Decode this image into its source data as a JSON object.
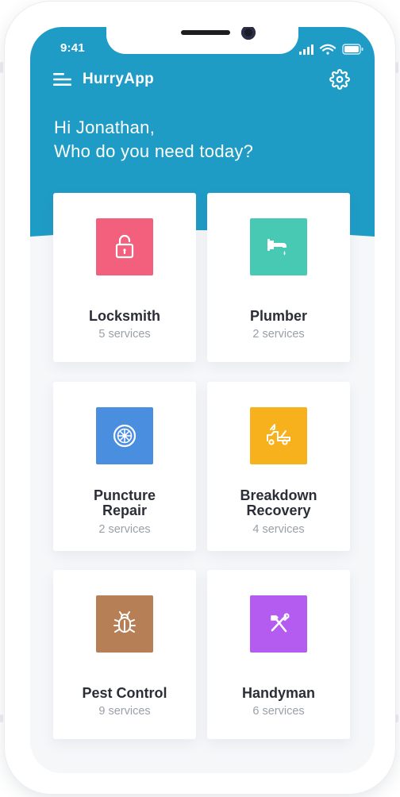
{
  "status_bar": {
    "time": "9:41"
  },
  "header": {
    "app_name": "HurryApp",
    "greeting_line1": "Hi Jonathan,",
    "greeting_line2": "Who do you need today?"
  },
  "colors": {
    "brand": "#1f9cc6",
    "locksmith": "#f2607d",
    "plumber": "#47c9b4",
    "puncture": "#4a8ee0",
    "breakdown": "#f6b11d",
    "pest": "#b77f55",
    "handyman": "#b45cf0"
  },
  "services": [
    {
      "name_line1": "Locksmith",
      "name_line2": "",
      "count": "5 services",
      "icon": "padlock-icon"
    },
    {
      "name_line1": "Plumber",
      "name_line2": "",
      "count": "2 services",
      "icon": "faucet-icon"
    },
    {
      "name_line1": "Puncture",
      "name_line2": "Repair",
      "count": "2 services",
      "icon": "tire-icon"
    },
    {
      "name_line1": "Breakdown",
      "name_line2": "Recovery",
      "count": "4 services",
      "icon": "tow-truck-icon"
    },
    {
      "name_line1": "Pest Control",
      "name_line2": "",
      "count": "9 services",
      "icon": "bug-icon"
    },
    {
      "name_line1": "Handyman",
      "name_line2": "",
      "count": "6 services",
      "icon": "hammer-icon"
    }
  ]
}
